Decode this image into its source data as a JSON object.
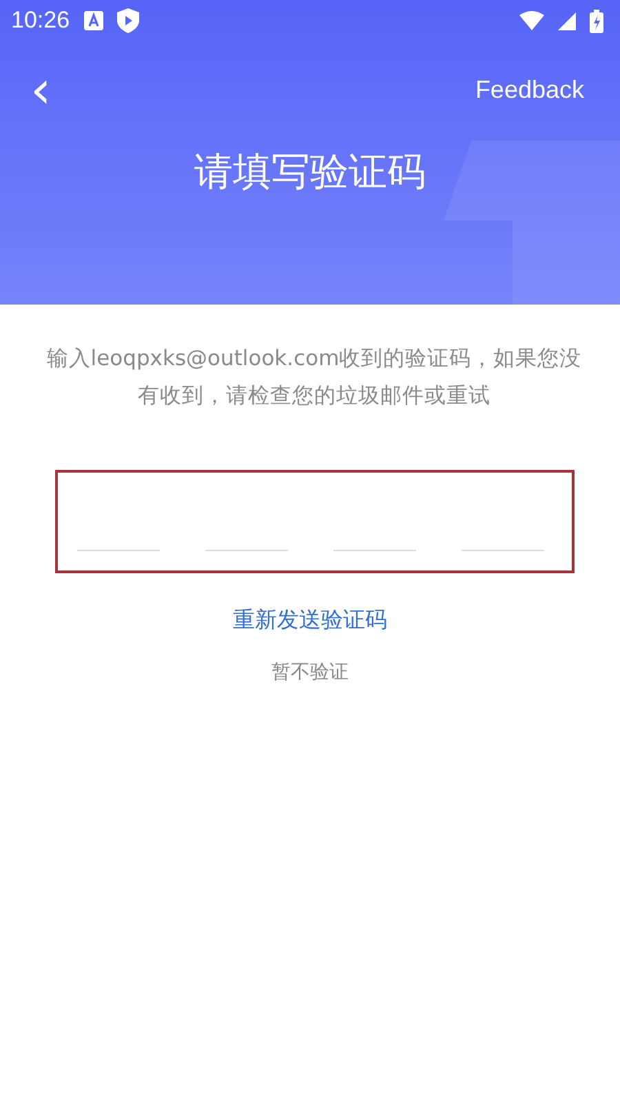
{
  "status_bar": {
    "time": "10:26"
  },
  "header": {
    "back": "‹",
    "action": "Feedback",
    "title": "请填写验证码"
  },
  "message": "输入leoqpxks@outlook.com收到的验证码，如果您没有收到，请检查您的垃圾邮件或重试",
  "code_input": {
    "highlighted": true,
    "fields": [
      {
        "kind": "digit"
      },
      {
        "kind": "digit"
      },
      {
        "kind": "digit"
      },
      {
        "kind": "digit"
      }
    ]
  },
  "resend_link": "重新发送验证码",
  "skip_link": "暂不验证"
}
